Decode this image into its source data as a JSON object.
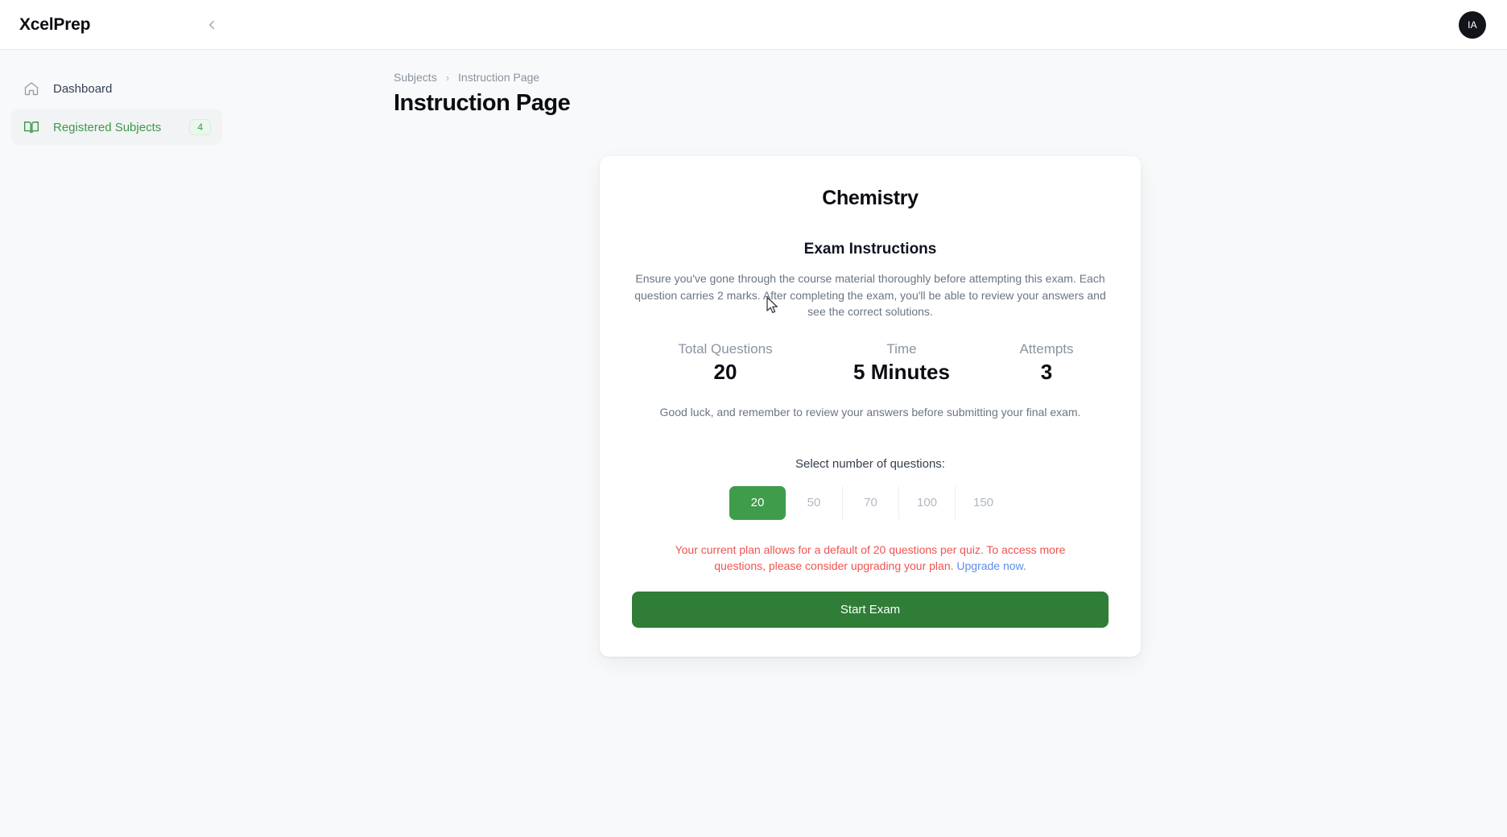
{
  "app": {
    "brand": "XcelPrep",
    "collapse_icon": "chevron-left-icon",
    "avatar_initials": "IA"
  },
  "sidebar": {
    "items": [
      {
        "label": "Dashboard",
        "icon": "home-icon",
        "badge": null,
        "active": false
      },
      {
        "label": "Registered Subjects",
        "icon": "book-open-icon",
        "badge": "4",
        "active": true
      }
    ]
  },
  "breadcrumb": {
    "parent": "Subjects",
    "separator": "›",
    "current": "Instruction Page"
  },
  "page": {
    "title": "Instruction Page"
  },
  "card": {
    "subject": "Chemistry",
    "section_title": "Exam Instructions",
    "intro": "Ensure you've gone through the course material thoroughly before attempting this exam. Each question carries 2 marks. After completing the exam, you'll be able to review your answers and see the correct solutions.",
    "stats": [
      {
        "label": "Total Questions",
        "value": "20"
      },
      {
        "label": "Time",
        "value": "5 Minutes"
      },
      {
        "label": "Attempts",
        "value": "3"
      }
    ],
    "goodluck": "Good luck, and remember to review your answers before submitting your final exam.",
    "select_label": "Select number of questions:",
    "question_options": [
      {
        "label": "20",
        "selected": true
      },
      {
        "label": "50",
        "selected": false
      },
      {
        "label": "70",
        "selected": false
      },
      {
        "label": "100",
        "selected": false
      },
      {
        "label": "150",
        "selected": false
      }
    ],
    "plan_note": "Your current plan allows for a default of 20 questions per quiz. To access more questions, please consider upgrading your plan. ",
    "plan_link": "Upgrade now",
    "plan_note_end": ".",
    "start_label": "Start Exam"
  },
  "colors": {
    "accent_green": "#3f9c4a",
    "button_green": "#2f7d36",
    "warning_red": "#ef5350",
    "link_blue": "#5b8def",
    "page_bg": "#f8f9fa"
  }
}
